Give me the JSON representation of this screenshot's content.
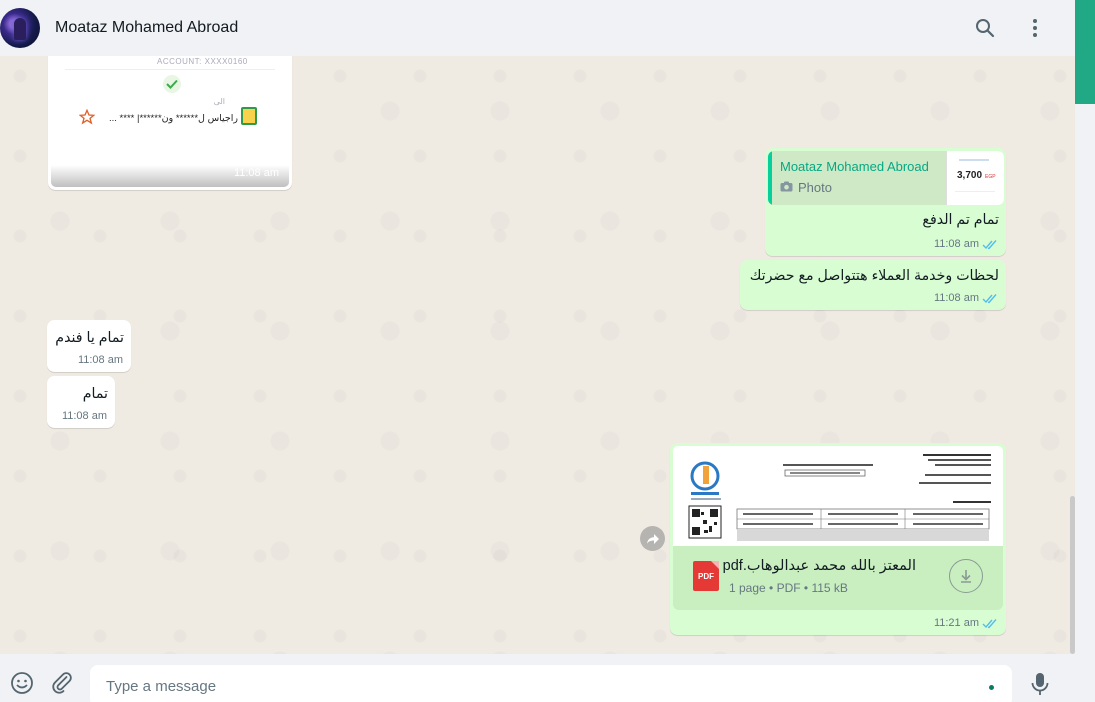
{
  "header": {
    "chat_name": "Moataz Mohamed Abroad",
    "icons": [
      "search-icon",
      "menu-icon"
    ]
  },
  "messages": {
    "image_receipt": {
      "account_text": "ACCOUNT: XXXX0160",
      "to_label": "الى",
      "recipient": "راجياس ل****** ون******| **** ...",
      "time": "11:08 am"
    },
    "reply_bubble": {
      "quote_author": "Moataz Mohamed Abroad",
      "quote_type": "Photo",
      "quote_amount": "3,700",
      "quote_currency": "EGP",
      "text": "تمام تم الدفع",
      "time": "11:08 am"
    },
    "out_text_2": {
      "text": "لحظات وخدمة العملاء هتتواصل مع حضرتك",
      "time": "11:08 am"
    },
    "in_text_1": {
      "text": "تمام يا فندم",
      "time": "11:08 am"
    },
    "in_text_2": {
      "text": "تمام",
      "time": "11:08 am"
    },
    "document": {
      "file_name": "المعتز بالله محمد عبدالوهاب.pdf",
      "meta": "1 page • PDF • 115 kB",
      "file_type_label": "PDF",
      "time": "11:21 am"
    }
  },
  "composer": {
    "placeholder": "Type a message"
  },
  "colors": {
    "accent": "#21a884",
    "outgoing_bubble": "#d9fdd3",
    "incoming_bubble": "#ffffff",
    "read_ticks": "#53bdeb"
  }
}
